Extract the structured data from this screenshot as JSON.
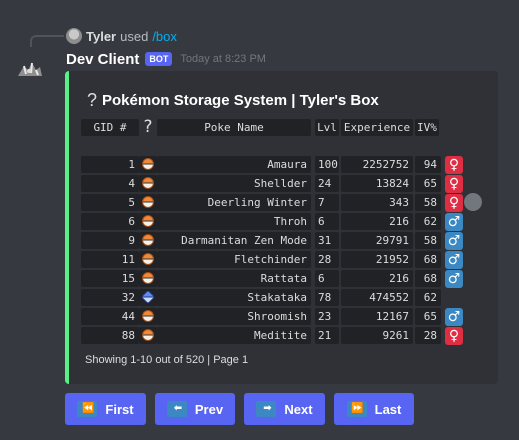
{
  "reply": {
    "user": "Tyler",
    "verb": "used",
    "command": "/box"
  },
  "message": {
    "author": "Dev Client",
    "tag": "BOT",
    "timestamp": "Today at 8:23 PM"
  },
  "embed": {
    "title_icon": "?",
    "title": "Pokémon Storage System | Tyler's Box",
    "columns": {
      "gid": "GID #",
      "icon": "?",
      "name": "Poke Name",
      "lvl": "Lvl",
      "exp": "Experience",
      "iv": "IV%"
    },
    "rows": [
      {
        "gid": "1",
        "ball": "poke-ball-icon",
        "name": "Amaura",
        "lvl": "100",
        "exp": "2252752",
        "iv": "94",
        "gender": "♀"
      },
      {
        "gid": "4",
        "ball": "poke-ball-icon",
        "name": "Shellder",
        "lvl": "24",
        "exp": "13824",
        "iv": "65",
        "gender": "♀"
      },
      {
        "gid": "5",
        "ball": "poke-ball-icon",
        "name": "Deerling Winter",
        "lvl": "7",
        "exp": "343",
        "iv": "58",
        "gender": "♀"
      },
      {
        "gid": "6",
        "ball": "poke-ball-icon",
        "name": "Throh",
        "lvl": "6",
        "exp": "216",
        "iv": "62",
        "gender": "♂"
      },
      {
        "gid": "9",
        "ball": "poke-ball-icon",
        "name": "Darmanitan Zen Mode",
        "lvl": "31",
        "exp": "29791",
        "iv": "58",
        "gender": "♂"
      },
      {
        "gid": "11",
        "ball": "poke-ball-icon",
        "name": "Fletchinder",
        "lvl": "28",
        "exp": "21952",
        "iv": "68",
        "gender": "♂"
      },
      {
        "gid": "15",
        "ball": "poke-ball-icon",
        "name": "Rattata",
        "lvl": "6",
        "exp": "216",
        "iv": "68",
        "gender": "♂"
      },
      {
        "gid": "32",
        "ball": "ultra-ball-icon",
        "name": "Stakataka",
        "lvl": "78",
        "exp": "474552",
        "iv": "62",
        "gender": ""
      },
      {
        "gid": "44",
        "ball": "poke-ball-icon",
        "name": "Shroomish",
        "lvl": "23",
        "exp": "12167",
        "iv": "65",
        "gender": "♂"
      },
      {
        "gid": "88",
        "ball": "poke-ball-icon",
        "name": "Meditite",
        "lvl": "21",
        "exp": "9261",
        "iv": "28",
        "gender": "♀"
      }
    ],
    "footer": "Showing 1-10 out of 520 | Page 1",
    "accent_color": "#57f287"
  },
  "buttons": [
    {
      "label": "First",
      "icon": "⏪",
      "icon_name": "rewind-icon"
    },
    {
      "label": "Prev",
      "icon": "⬅",
      "icon_name": "arrow-left-icon"
    },
    {
      "label": "Next",
      "icon": "➡",
      "icon_name": "arrow-right-icon"
    },
    {
      "label": "Last",
      "icon": "⏩",
      "icon_name": "fast-forward-icon"
    }
  ],
  "colors": {
    "background": "#36393f",
    "embed": "#2f3136",
    "button": "#5865f2",
    "female": "#dd2e44",
    "male": "#3b88c3"
  }
}
